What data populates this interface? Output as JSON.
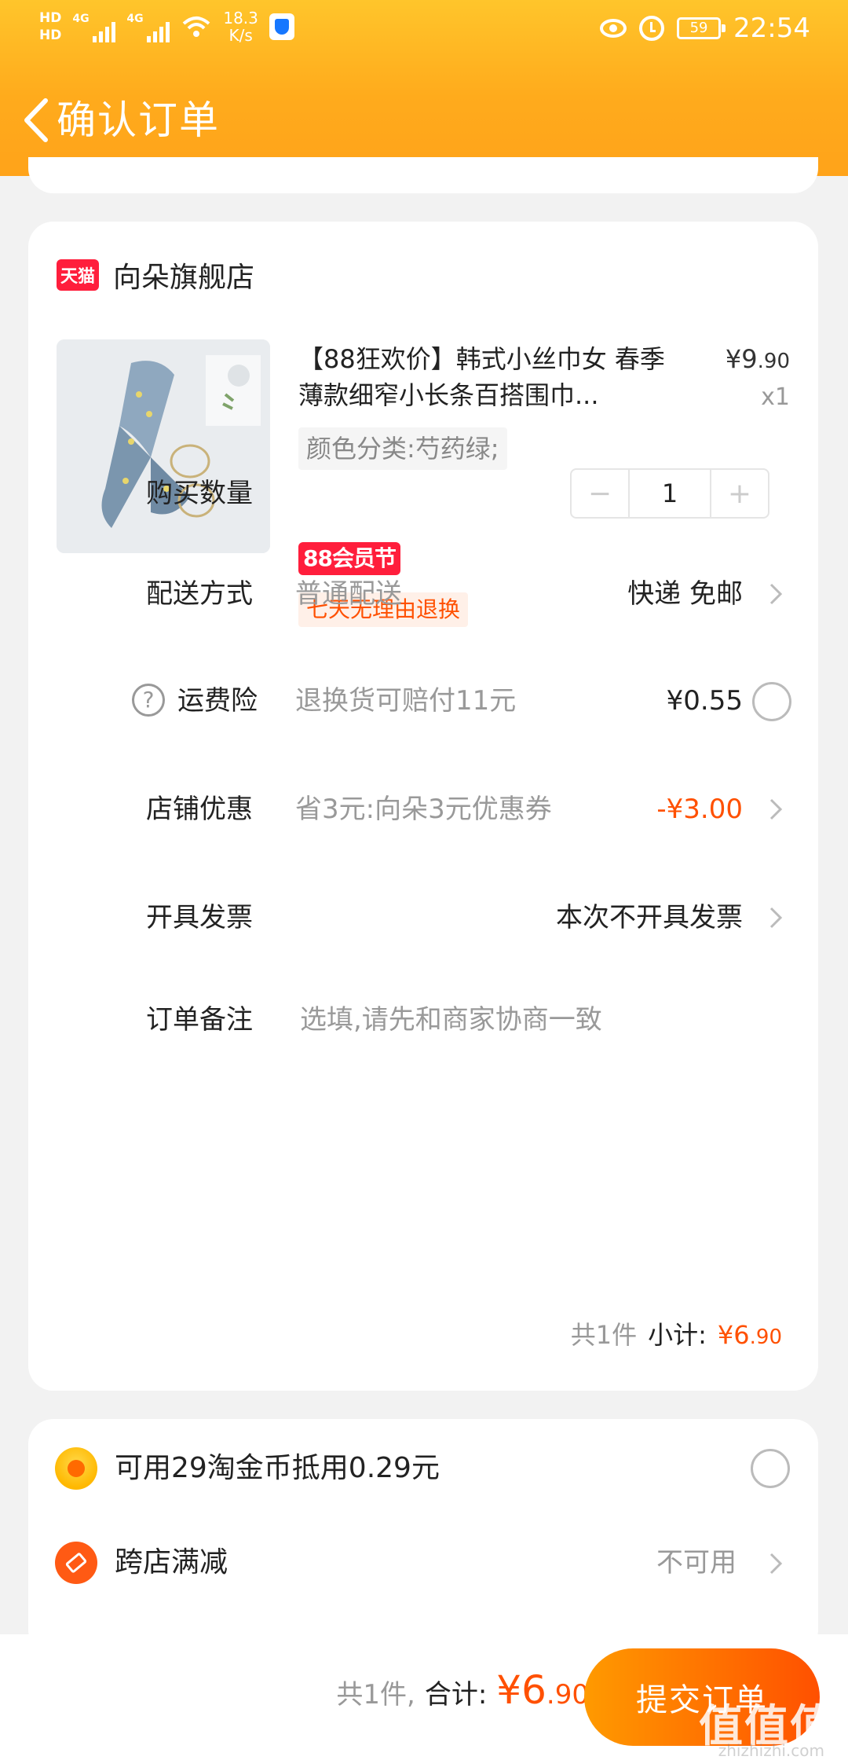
{
  "status_bar": {
    "hd_1": "HD",
    "hd_2": "HD",
    "net_1": "4G",
    "net_2": "4G",
    "speed": "18.3",
    "speed_unit": "K/s",
    "battery": "59",
    "time": "22:54"
  },
  "header": {
    "title": "确认订单"
  },
  "shop": {
    "badge": "天猫",
    "name": "向朵旗舰店"
  },
  "product": {
    "title": "【88狂欢价】韩式小丝巾女 春季薄款细窄小长条百搭围巾...",
    "price_main": "¥9",
    "price_decimal": ".90",
    "quantity": "x1",
    "sku": "颜色分类:芍药绿;",
    "promo_badge": "88会员节",
    "return_badge": "七天无理由退换"
  },
  "rows": {
    "quantity": {
      "label": "购买数量",
      "value": "1",
      "minus": "−",
      "plus": "+"
    },
    "delivery": {
      "label": "配送方式",
      "sub": "普通配送",
      "value": "快递 免邮"
    },
    "insurance": {
      "label": "运费险",
      "help": "?",
      "sub": "退换货可赔付11元",
      "value": "¥0.55"
    },
    "shop_discount": {
      "label": "店铺优惠",
      "sub": "省3元:向朵3元优惠券",
      "value": "-¥3.00"
    },
    "invoice": {
      "label": "开具发票",
      "value": "本次不开具发票"
    },
    "note": {
      "label": "订单备注",
      "placeholder": "选填,请先和商家协商一致"
    }
  },
  "subtotal": {
    "count": "共1件",
    "label": "小计:",
    "amount_main": "¥6",
    "amount_decimal": ".90"
  },
  "perks": {
    "coins": {
      "label": "可用29淘金币抵用0.29元"
    },
    "cross_store": {
      "label": "跨店满减",
      "value": "不可用"
    }
  },
  "footer": {
    "count": "共1件,",
    "total_label": "合计:",
    "total_main": "¥6",
    "total_decimal": ".90",
    "submit": "提交订单",
    "watermark": "值值值",
    "watermark_sub": "zhizhizhi.com"
  },
  "colors": {
    "header": "#ffab1c",
    "accent": "#ff5000",
    "tmall": "#ff1e3c"
  }
}
